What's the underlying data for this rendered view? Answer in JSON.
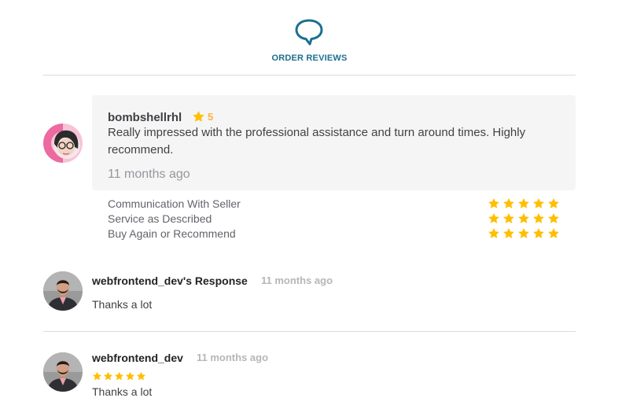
{
  "header": {
    "title": "ORDER REVIEWS",
    "icon": "speech-bubble-icon",
    "accent": "#1d6f8e"
  },
  "review": {
    "reviewer": "bombshellrhl",
    "rating": "5",
    "text": "Really impressed with the professional assistance and turn around times. Highly recommend.",
    "time": "11 months ago",
    "star_color": "#ffbe00",
    "breakdown": [
      {
        "label": "Communication With Seller",
        "stars": 5
      },
      {
        "label": "Service as Described",
        "stars": 5
      },
      {
        "label": "Buy Again or Recommend",
        "stars": 5
      }
    ]
  },
  "seller_response": {
    "name": "webfrontend_dev's Response",
    "time": "11 months ago",
    "text": "Thanks a lot"
  },
  "seller_review": {
    "name": "webfrontend_dev",
    "time": "11 months ago",
    "stars": 5,
    "text": "Thanks a lot"
  }
}
